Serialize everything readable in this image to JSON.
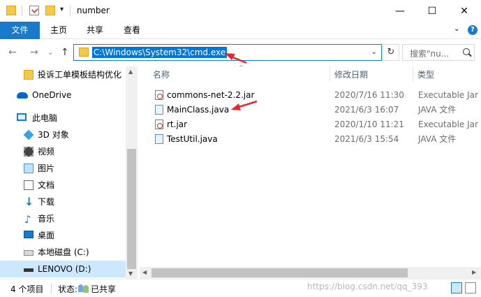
{
  "window": {
    "title": "number",
    "minimize_glyph": "—",
    "maximize_glyph": "☐",
    "close_glyph": "✕",
    "quick_access_dropdown": "▾"
  },
  "ribbon": {
    "tabs": [
      "文件",
      "主页",
      "共享",
      "查看"
    ],
    "expand_glyph": "⌄",
    "help_glyph": "?"
  },
  "navigation": {
    "back_glyph": "←",
    "forward_glyph": "→",
    "recent_glyph": "⌄",
    "up_glyph": "↑",
    "address": "C:\\Windows\\System32\\cmd.exe",
    "address_dropdown": "⌄",
    "refresh_glyph": "↻",
    "search_placeholder": "搜索\"nu..."
  },
  "sidebar": {
    "items": [
      {
        "label": "投诉工单模板结构优化",
        "icon": "folder-icon"
      },
      {
        "label": "OneDrive",
        "icon": "onedrive-icon"
      },
      {
        "label": "此电脑",
        "icon": "this-pc-icon"
      },
      {
        "label": "3D 对象",
        "icon": "3d-objects-icon"
      },
      {
        "label": "视频",
        "icon": "videos-icon"
      },
      {
        "label": "图片",
        "icon": "pictures-icon"
      },
      {
        "label": "文档",
        "icon": "documents-icon"
      },
      {
        "label": "下载",
        "icon": "downloads-icon"
      },
      {
        "label": "音乐",
        "icon": "music-icon"
      },
      {
        "label": "桌面",
        "icon": "desktop-icon"
      },
      {
        "label": "本地磁盘 (C:)",
        "icon": "local-disk-icon"
      },
      {
        "label": "LENOVO (D:)",
        "icon": "drive-icon"
      }
    ],
    "selected": "LENOVO (D:)"
  },
  "file_list": {
    "columns": [
      "名称",
      "修改日期",
      "类型"
    ],
    "sort_glyph": "^",
    "files": [
      {
        "name": "commons-net-2.2.jar",
        "modified": "2020/7/16 11:30",
        "type": "Executable Jar F",
        "icon": "jar-file-icon"
      },
      {
        "name": "MainClass.java",
        "modified": "2021/6/3 16:07",
        "type": "JAVA 文件",
        "icon": "java-file-icon"
      },
      {
        "name": "rt.jar",
        "modified": "2020/1/10 11:21",
        "type": "Executable Jar F",
        "icon": "jar-file-icon"
      },
      {
        "name": "TestUtil.java",
        "modified": "2021/6/3 15:54",
        "type": "JAVA 文件",
        "icon": "java-file-icon"
      }
    ]
  },
  "scroll_glyphs": {
    "up": "▲",
    "down": "▼",
    "left": "◀",
    "right": "▶"
  },
  "status": {
    "item_count": "4 个项目",
    "state_label": "状态:",
    "state_value": "已共享",
    "watermark": "https://blog.csdn.net/qq_393"
  },
  "colors": {
    "accent": "#1979ca",
    "selection": "#cce8ff",
    "address_highlight": "#0078d7",
    "annotation_arrow": "#e8262b"
  }
}
